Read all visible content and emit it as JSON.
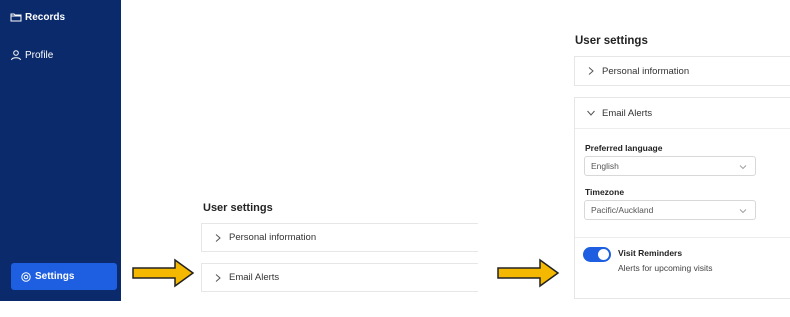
{
  "sidebar": {
    "items": [
      {
        "label": "Records",
        "icon": "folder-icon"
      },
      {
        "label": "Profile",
        "icon": "user-icon"
      },
      {
        "label": "Settings",
        "icon": "gear-icon",
        "active": true
      }
    ],
    "bg_color": "#0b2a6b",
    "active_color": "#1d5fe0"
  },
  "arrows": {
    "color": "#f5b800"
  },
  "middle_panel": {
    "title": "User settings",
    "sections": [
      {
        "label": "Personal information",
        "expanded": false
      },
      {
        "label": "Email Alerts",
        "expanded": false
      }
    ]
  },
  "right_panel": {
    "title": "User settings",
    "sections": [
      {
        "label": "Personal information",
        "expanded": false
      },
      {
        "label": "Email Alerts",
        "expanded": true
      }
    ],
    "preferred_language": {
      "label": "Preferred language",
      "value": "English"
    },
    "timezone": {
      "label": "Timezone",
      "value": "Pacific/Auckland"
    },
    "visit_reminders": {
      "title": "Visit Reminders",
      "description": "Alerts for upcoming visits",
      "enabled": true
    }
  }
}
